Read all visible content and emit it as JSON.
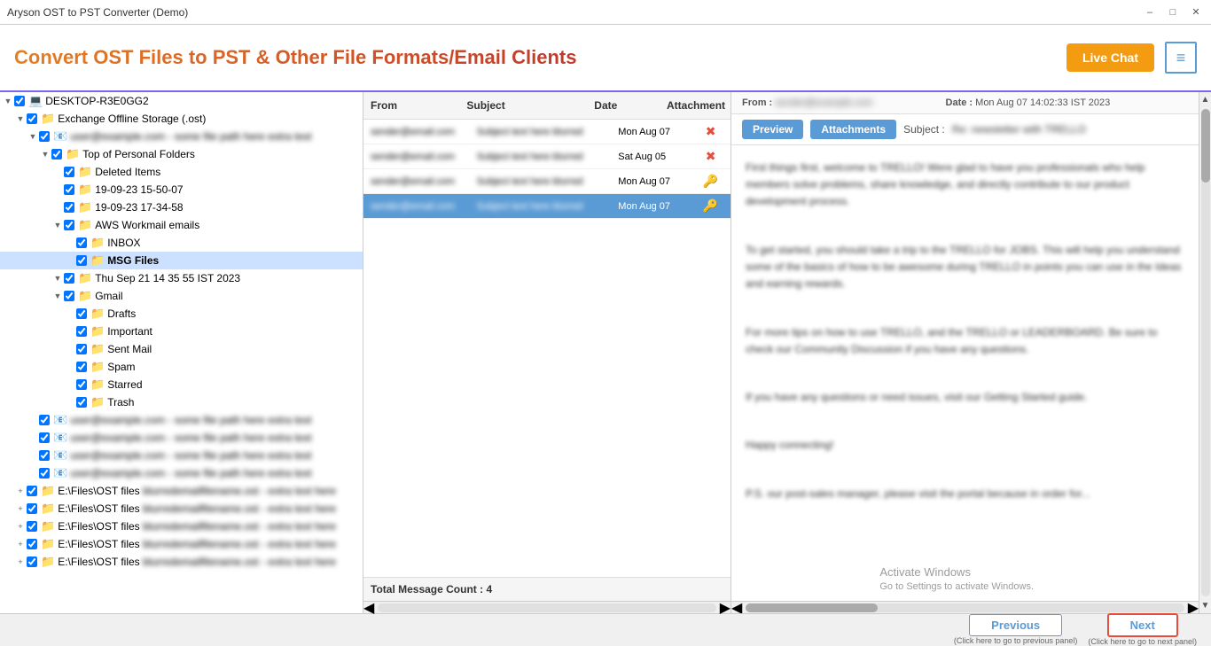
{
  "titleBar": {
    "title": "Aryson OST to PST Converter (Demo)",
    "minimize": "–",
    "maximize": "□",
    "close": "✕"
  },
  "header": {
    "appTitle": "Convert OST Files to PST & Other File Formats/Email Clients",
    "liveChat": "Live Chat",
    "menuIcon": "≡"
  },
  "treePanel": {
    "items": [
      {
        "level": 0,
        "expander": "▼",
        "checked": true,
        "icon": "💻",
        "label": "DESKTOP-R3E0GG2",
        "blurred": false
      },
      {
        "level": 1,
        "expander": "▼",
        "checked": true,
        "icon": "📁",
        "iconColor": "yellow",
        "label": "Exchange Offline Storage (.ost)",
        "blurred": false
      },
      {
        "level": 2,
        "expander": "▼",
        "checked": true,
        "icon": "📧",
        "label": "blurred-email-row-1",
        "blurred": true
      },
      {
        "level": 3,
        "expander": "▼",
        "checked": true,
        "icon": "📁",
        "iconColor": "yellow",
        "label": "Top of Personal Folders",
        "blurred": false
      },
      {
        "level": 4,
        "expander": "",
        "checked": true,
        "icon": "📁",
        "iconColor": "blue",
        "label": "Deleted Items",
        "blurred": false
      },
      {
        "level": 4,
        "expander": "",
        "checked": true,
        "icon": "📁",
        "iconColor": "blue",
        "label": "19-09-23 15-50-07",
        "blurred": false
      },
      {
        "level": 4,
        "expander": "",
        "checked": true,
        "icon": "📁",
        "iconColor": "blue",
        "label": "19-09-23 17-34-58",
        "blurred": false
      },
      {
        "level": 4,
        "expander": "▼",
        "checked": true,
        "icon": "📁",
        "iconColor": "yellow",
        "label": "AWS Workmail emails",
        "blurred": false
      },
      {
        "level": 5,
        "expander": "",
        "checked": true,
        "icon": "📁",
        "iconColor": "blue",
        "label": "INBOX",
        "blurred": false
      },
      {
        "level": 5,
        "expander": "",
        "checked": true,
        "icon": "📁",
        "iconColor": "blue",
        "label": "MSG Files",
        "selected": true,
        "blurred": false
      },
      {
        "level": 4,
        "expander": "▼",
        "checked": true,
        "icon": "📁",
        "iconColor": "yellow",
        "label": "Thu Sep 21 14 35 55 IST 2023",
        "blurred": false
      },
      {
        "level": 4,
        "expander": "▼",
        "checked": true,
        "icon": "📁",
        "iconColor": "yellow",
        "label": "Gmail",
        "blurred": false
      },
      {
        "level": 5,
        "expander": "",
        "checked": true,
        "icon": "📁",
        "iconColor": "blue",
        "label": "Drafts",
        "blurred": false
      },
      {
        "level": 5,
        "expander": "",
        "checked": true,
        "icon": "📁",
        "iconColor": "blue",
        "label": "Important",
        "blurred": false
      },
      {
        "level": 5,
        "expander": "",
        "checked": true,
        "icon": "📁",
        "iconColor": "blue",
        "label": "Sent Mail",
        "blurred": false
      },
      {
        "level": 5,
        "expander": "",
        "checked": true,
        "icon": "📁",
        "iconColor": "blue",
        "label": "Spam",
        "blurred": false
      },
      {
        "level": 5,
        "expander": "",
        "checked": true,
        "icon": "📁",
        "iconColor": "blue",
        "label": "Starred",
        "blurred": false
      },
      {
        "level": 5,
        "expander": "",
        "checked": true,
        "icon": "📁",
        "iconColor": "blue",
        "label": "Trash",
        "blurred": false
      },
      {
        "level": 2,
        "expander": "",
        "checked": true,
        "icon": "📧",
        "label": "blurred-email-2",
        "blurred": true
      },
      {
        "level": 2,
        "expander": "",
        "checked": true,
        "icon": "📧",
        "label": "blurred-email-3",
        "blurred": true
      },
      {
        "level": 2,
        "expander": "",
        "checked": true,
        "icon": "📧",
        "label": "blurred-email-4",
        "blurred": true
      },
      {
        "level": 2,
        "expander": "",
        "checked": true,
        "icon": "📧",
        "label": "blurred-email-5",
        "blurred": true
      },
      {
        "level": 1,
        "expander": "+",
        "checked": true,
        "icon": "📁",
        "iconColor": "yellow",
        "label": "E:\\Files\\OST files",
        "labelExtra": "blurred-extra-1",
        "blurred": true
      },
      {
        "level": 1,
        "expander": "+",
        "checked": true,
        "icon": "📁",
        "iconColor": "yellow",
        "label": "E:\\Files\\OST files",
        "labelExtra": "blurred-extra-2",
        "blurred": true
      },
      {
        "level": 1,
        "expander": "+",
        "checked": true,
        "icon": "📁",
        "iconColor": "yellow",
        "label": "E:\\Files\\OST files",
        "labelExtra": "blurred-extra-3",
        "blurred": true
      },
      {
        "level": 1,
        "expander": "+",
        "checked": true,
        "icon": "📁",
        "iconColor": "yellow",
        "label": "E:\\Files\\OST files",
        "labelExtra": "blurred-extra-4",
        "blurred": true
      },
      {
        "level": 1,
        "expander": "+",
        "checked": true,
        "icon": "📁",
        "iconColor": "yellow",
        "label": "E:\\Files\\OST files",
        "labelExtra": "blurred-extra-5",
        "blurred": true
      }
    ]
  },
  "messageList": {
    "columns": {
      "from": "From",
      "subject": "Subject",
      "date": "Date",
      "attachment": "Attachment"
    },
    "rows": [
      {
        "from": "blurred",
        "subject": "blurred",
        "date": "Mon Aug 07",
        "attachment": "❌",
        "attachColor": "red",
        "selected": false
      },
      {
        "from": "blurred",
        "subject": "blurred",
        "date": "Sat Aug 05",
        "attachment": "❌",
        "attachColor": "red",
        "selected": false
      },
      {
        "from": "blurred",
        "subject": "blurred",
        "date": "Mon Aug 07",
        "attachment": "🔑",
        "attachColor": "green",
        "selected": false
      },
      {
        "from": "blurred",
        "subject": "blurred",
        "date": "Mon Aug 07",
        "attachment": "🔑",
        "attachColor": "green",
        "selected": true
      }
    ],
    "totalCount": "Total Message Count : 4"
  },
  "preview": {
    "fromLabel": "From :",
    "fromValue": "blurred-from-email",
    "dateLabel": "Date :",
    "dateValue": "Mon Aug 07 14:02:33 IST 2023",
    "previewBtn": "Preview",
    "attachmentsBtn": "Attachments",
    "subjectLabel": "Subject :",
    "subjectValue": "blurred-subject-text",
    "body": [
      "First things first, welcome to TRELLO! Were glad to have you professionals who help members solve problems, share knowledge, and directly contribute to our product development process.",
      "",
      "To get started, you should take a trip to the TRELLO for JOBS. This will help you understand some of the basics of how to be awesome during TRELLO in points you can use in the Ideas and earning rewards.",
      "",
      "For more tips on how to use TRELLO, and the TRELLO or LEADERBOARD. Be sure to check our Community Discussion if you have any questions.",
      "",
      "If you have any questions or need issues, visit our Getting Started guide.",
      "",
      "Happy connecting!",
      "",
      "P.S. our post-sales manager, please visit the portal because in order for..."
    ]
  },
  "bottomBar": {
    "prevBtn": "Previous",
    "prevHint": "(Click here to go to previous panel)",
    "nextBtn": "Next",
    "nextHint": "(Click here to go to next panel)"
  },
  "watermark": "Activate Windows\nGo to Settings to activate Windows."
}
